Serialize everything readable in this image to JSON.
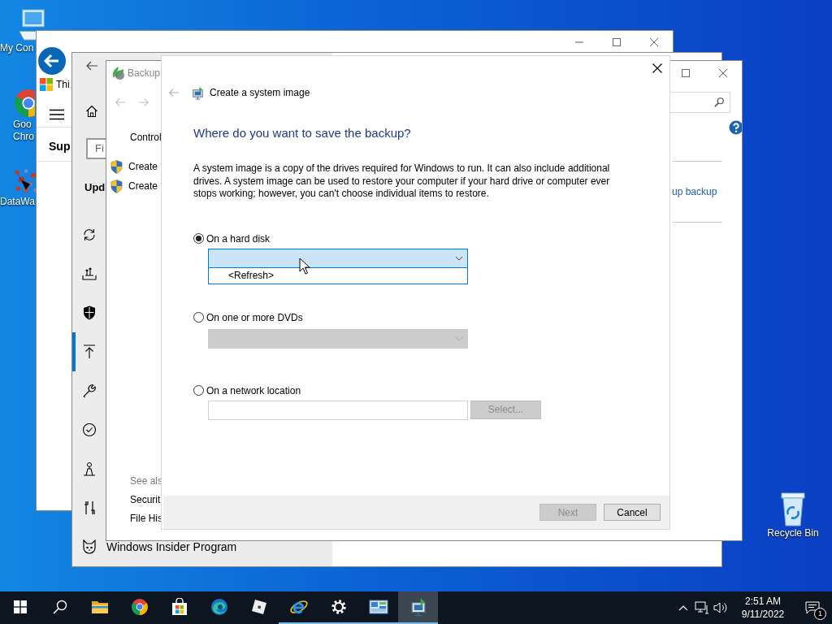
{
  "desktop_icons": [
    {
      "kind": "computer",
      "lines": [
        "My Con"
      ]
    },
    {
      "kind": "chrome",
      "lines": [
        "Goo",
        "Chro"
      ]
    },
    {
      "kind": "datawa",
      "lines": [
        "DataWa"
      ]
    },
    {
      "kind": "recycle",
      "lines": [
        "Recycle Bin"
      ]
    }
  ],
  "support_window": {
    "title": "Thi",
    "heading": "Sup"
  },
  "settings_window": {
    "search": {
      "placeholder": "Fi"
    },
    "heading": "Upd",
    "nav": [
      {
        "kind": "sync",
        "selected": false
      },
      {
        "kind": "delivery",
        "selected": false
      },
      {
        "kind": "shield",
        "selected": false
      },
      {
        "kind": "backup",
        "selected": true
      },
      {
        "kind": "wrench",
        "selected": false
      },
      {
        "kind": "check",
        "selected": false
      },
      {
        "kind": "person",
        "selected": false
      },
      {
        "kind": "tools",
        "selected": false
      },
      {
        "kind": "cat",
        "label": "Windows Insider Program",
        "selected": false
      }
    ]
  },
  "backup_window": {
    "title": "Backup",
    "links": [
      {
        "kind": "plain",
        "text": "Control"
      },
      {
        "kind": "shield",
        "text": "Create"
      },
      {
        "kind": "shield",
        "text": "Create"
      }
    ],
    "see_also": {
      "title": "See als",
      "links": [
        "Securit",
        "File His"
      ]
    },
    "right_link": "up backup"
  },
  "dialog": {
    "title": "Create a system image",
    "heading": "Where do you want to save the backup?",
    "description": "A system image is a copy of the drives required for Windows to run. It can also include additional drives. A system image can be used to restore your computer if your hard drive or computer ever stops working; however, you can't choose individual items to restore.",
    "options": [
      {
        "kind": "combo",
        "label": "On a hard disk",
        "selected": true,
        "open": true,
        "disabled": false,
        "items": [
          "<Refresh>"
        ]
      },
      {
        "kind": "combo",
        "label": "On one or more DVDs",
        "selected": false,
        "open": false,
        "disabled": true
      },
      {
        "kind": "path",
        "label": "On a network location",
        "selected": false,
        "button": {
          "label": "Select...",
          "disabled": true
        }
      }
    ],
    "buttons": [
      {
        "label": "Next",
        "disabled": true
      },
      {
        "label": "Cancel",
        "disabled": false
      }
    ]
  },
  "taskbar": {
    "apps": [
      {
        "kind": "start",
        "running": false,
        "selected": false
      },
      {
        "kind": "search",
        "running": false,
        "selected": false
      },
      {
        "kind": "folder",
        "running": false,
        "selected": false
      },
      {
        "kind": "chrome",
        "running": false,
        "selected": false
      },
      {
        "kind": "store",
        "running": false,
        "selected": false
      },
      {
        "kind": "edge",
        "running": false,
        "selected": false
      },
      {
        "kind": "cube",
        "running": false,
        "selected": false
      },
      {
        "kind": "ie",
        "running": true,
        "selected": false
      },
      {
        "kind": "gear",
        "running": true,
        "selected": false
      },
      {
        "kind": "panel",
        "running": true,
        "selected": false
      },
      {
        "kind": "sysimage",
        "running": true,
        "selected": true
      }
    ],
    "clock": {
      "time": "2:51 AM",
      "date": "9/11/2022"
    },
    "notifications": {
      "count": "1"
    }
  }
}
